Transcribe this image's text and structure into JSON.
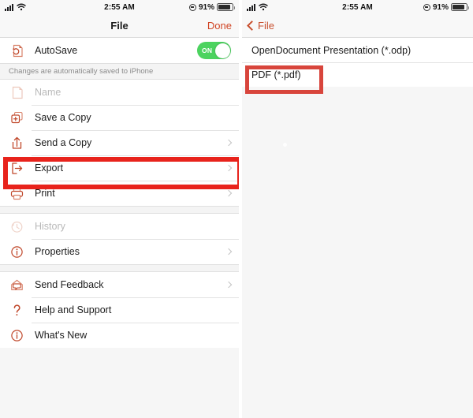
{
  "statusbar": {
    "time": "2:55 AM",
    "battery_percent": "91%",
    "signal_icon": "cellular-signal-icon",
    "wifi_icon": "wifi-icon",
    "location_icon": "location-indicator-icon",
    "battery_icon": "battery-icon"
  },
  "left_screen": {
    "nav": {
      "title": "File",
      "done_label": "Done"
    },
    "autosave": {
      "label": "AutoSave",
      "icon": "autosave-document-refresh-icon",
      "toggle_state": "ON",
      "toggle_color": "#4cd35f"
    },
    "note": "Changes are automatically saved to iPhone",
    "group1": [
      {
        "label": "Name",
        "icon": "document-icon",
        "disabled": true,
        "chevron": false
      },
      {
        "label": "Save a Copy",
        "icon": "save-copy-plus-icon",
        "disabled": false,
        "chevron": false
      },
      {
        "label": "Send a Copy",
        "icon": "share-upload-icon",
        "disabled": false,
        "chevron": true
      },
      {
        "label": "Export",
        "icon": "export-arrow-icon",
        "disabled": false,
        "chevron": true
      },
      {
        "label": "Print",
        "icon": "printer-icon",
        "disabled": false,
        "chevron": true
      }
    ],
    "group2": [
      {
        "label": "History",
        "icon": "history-clock-icon",
        "disabled": true,
        "chevron": false
      },
      {
        "label": "Properties",
        "icon": "info-circle-icon",
        "disabled": false,
        "chevron": true
      }
    ],
    "group3": [
      {
        "label": "Send Feedback",
        "icon": "feedback-envelope-icon",
        "disabled": false,
        "chevron": true
      },
      {
        "label": "Help and Support",
        "icon": "question-mark-icon",
        "disabled": false,
        "chevron": false
      },
      {
        "label": "What's New",
        "icon": "info-circle-icon",
        "disabled": false,
        "chevron": false
      }
    ]
  },
  "right_screen": {
    "nav": {
      "back_label": "File",
      "back_icon": "chevron-left-icon"
    },
    "format_options": [
      {
        "label": "OpenDocument Presentation (*.odp)"
      },
      {
        "label": "PDF (*.pdf)"
      }
    ]
  },
  "annotations": {
    "color": "#e8231c",
    "highlighted_left_row": "Export",
    "highlighted_right_row": "PDF (*.pdf)"
  }
}
